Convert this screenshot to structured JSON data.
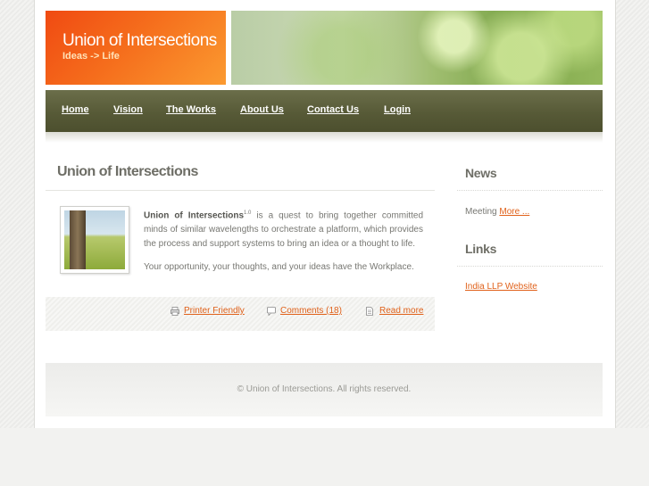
{
  "header": {
    "site_title": "Union of Intersections",
    "slogan": "Ideas -> Life"
  },
  "nav": {
    "items": [
      {
        "label": "Home"
      },
      {
        "label": "Vision"
      },
      {
        "label": "The Works"
      },
      {
        "label": "About Us"
      },
      {
        "label": "Contact Us"
      },
      {
        "label": "Login"
      }
    ]
  },
  "content": {
    "title": "Union of Intersections",
    "intro_bold": "Union of Intersections",
    "intro_sup": "1.0",
    "intro_rest": " is a quest to bring together committed minds of similar wavelengths to orchestrate a platform, which provides the process and support systems to bring an idea or a thought to life.",
    "paragraph2": "Your opportunity, your thoughts, and your ideas have the Workplace.",
    "links": {
      "printer": "Printer Friendly",
      "comments": "Comments (18)",
      "read_more": "Read more"
    }
  },
  "sidebar": {
    "news_title": "News",
    "news_text": "Meeting ",
    "news_link": "More ...",
    "links_title": "Links",
    "links_item": "India LLP Website"
  },
  "footer": {
    "copyright": "© Union of Intersections. All rights reserved."
  },
  "colors": {
    "accent_orange": "#e0611a",
    "nav_olive": "#575a37",
    "header_orange": "#f56d1c"
  }
}
